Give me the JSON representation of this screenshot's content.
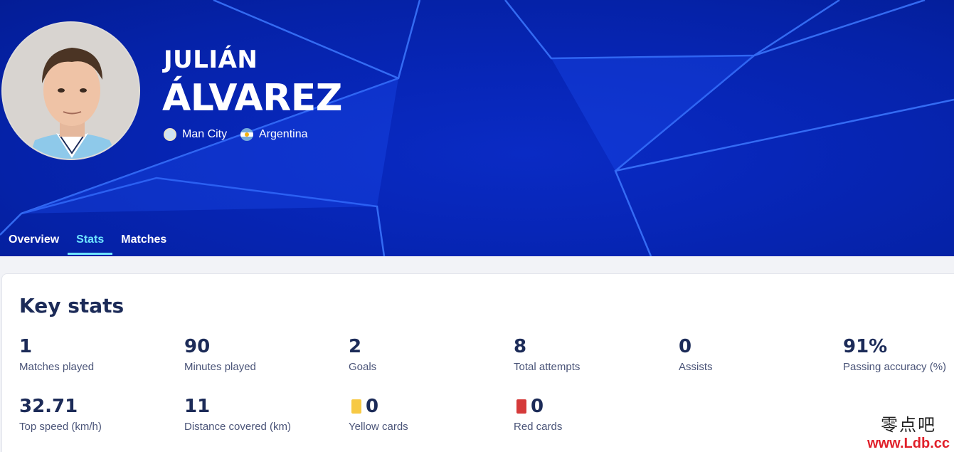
{
  "player": {
    "first_name": "JULIÁN",
    "last_name": "ÁLVAREZ",
    "club": "Man City",
    "country": "Argentina"
  },
  "tabs": [
    {
      "label": "Overview",
      "active": false
    },
    {
      "label": "Stats",
      "active": true
    },
    {
      "label": "Matches",
      "active": false
    }
  ],
  "key_stats": {
    "title": "Key stats",
    "items": [
      {
        "value": "1",
        "label": "Matches played"
      },
      {
        "value": "90",
        "label": "Minutes played"
      },
      {
        "value": "2",
        "label": "Goals"
      },
      {
        "value": "8",
        "label": "Total attempts"
      },
      {
        "value": "0",
        "label": "Assists"
      },
      {
        "value": "91%",
        "label": "Passing accuracy (%)"
      },
      {
        "value": "32.71",
        "label": "Top speed (km/h)"
      },
      {
        "value": "11",
        "label": "Distance covered (km)"
      },
      {
        "value": "0",
        "label": "Yellow cards",
        "icon": "yellow-card-icon"
      },
      {
        "value": "0",
        "label": "Red cards",
        "icon": "red-card-icon"
      }
    ]
  },
  "watermark": {
    "cn": "零点吧",
    "url": "www.Ldb.cc"
  },
  "colors": {
    "hero_bg": "#0726b8",
    "accent": "#6ee4ff",
    "text_dark": "#1c2b58",
    "yellow_card": "#f7c944",
    "red_card": "#d53a3a"
  }
}
